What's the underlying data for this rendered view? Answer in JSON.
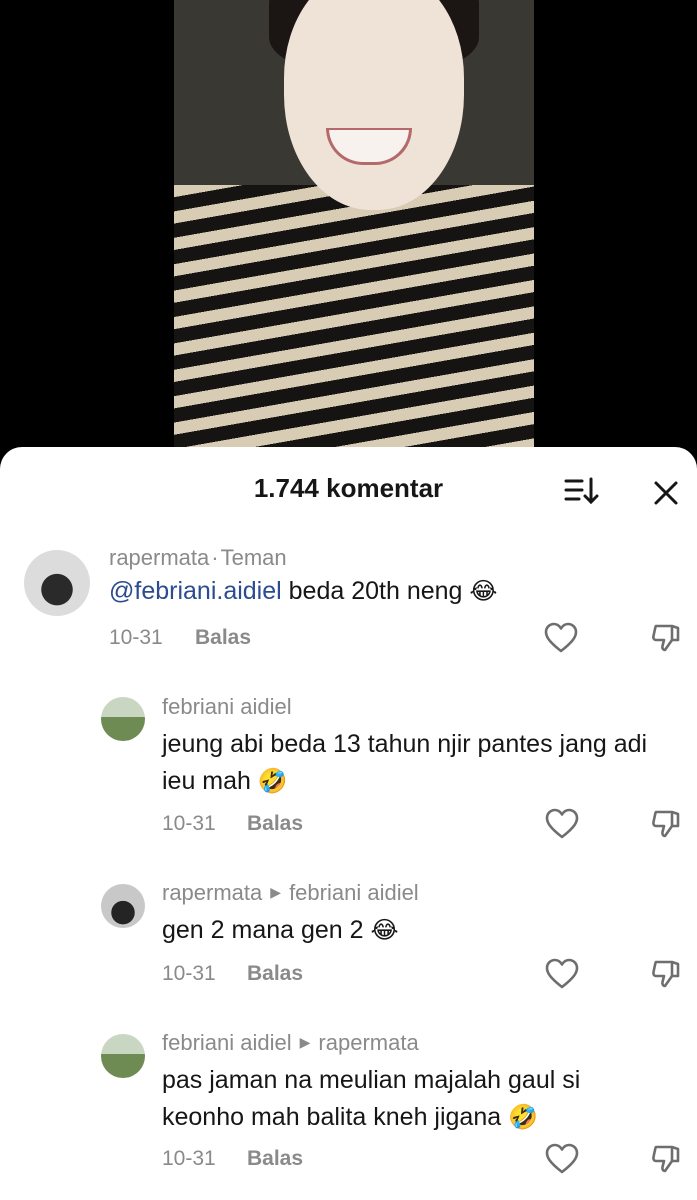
{
  "header": {
    "count_label": "1.744 komentar"
  },
  "comments": [
    {
      "author": "rapermata",
      "badge": "Teman",
      "mention": "@febriani.aidiel",
      "text": "beda 20th neng",
      "emoji": "😂",
      "date": "10-31",
      "reply_label": "Balas"
    },
    {
      "author": "febriani aidiel",
      "text_line1": "jeung abi beda 13 tahun njir pantes jang adi",
      "text_line2": "ieu mah",
      "emoji": "🤣",
      "date": "10-31",
      "reply_label": "Balas"
    },
    {
      "author": "rapermata",
      "reply_to": "febriani aidiel",
      "text": "gen 2 mana gen 2",
      "emoji": "😂",
      "date": "10-31",
      "reply_label": "Balas"
    },
    {
      "author": "febriani aidiel",
      "reply_to": "rapermata",
      "text_line1": "pas jaman na meulian majalah gaul si",
      "text_line2": "keonho mah balita kneh jigana",
      "emoji": "🤣",
      "date": "10-31",
      "reply_label": "Balas"
    }
  ]
}
